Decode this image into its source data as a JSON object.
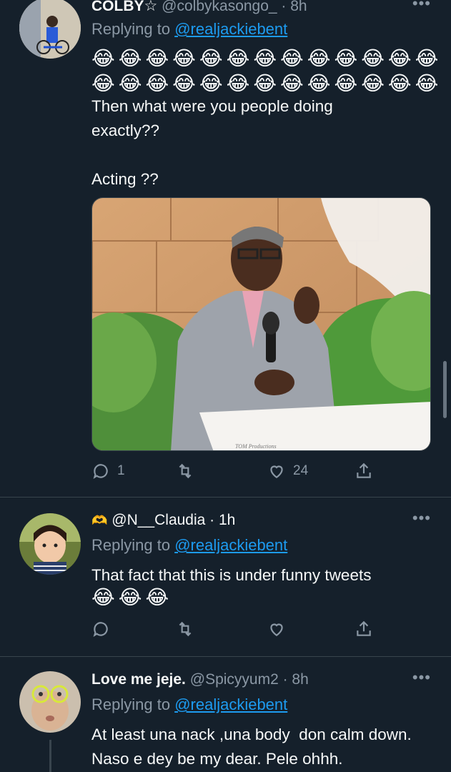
{
  "tweets": [
    {
      "name": "COLBY☆",
      "handle": "@colbykasongo_ · 8h",
      "replying_prefix": "Replying to ",
      "replying_handle": "@realjackiebent",
      "emoji": "😂",
      "emoji_rows": [
        13,
        13
      ],
      "text": "Then what were you people doing exactly??\n\nActing ??",
      "image_caption": "TOM Productions",
      "stats": {
        "replies": "1",
        "retweets": "",
        "likes": "24"
      }
    },
    {
      "name_icon": "🫶",
      "handle": "@N__Claudia · 1h",
      "replying_prefix": "Replying to ",
      "replying_handle": "@realjackiebent",
      "text": "That fact that this is under funny tweets",
      "emoji": "😂",
      "emoji_rows": [
        3
      ],
      "stats": {
        "replies": "",
        "retweets": "",
        "likes": ""
      }
    },
    {
      "name": "Love me jeje.",
      "handle": "@Spicyyum2 · 8h",
      "replying_prefix": "Replying to ",
      "replying_handle": "@realjackiebent",
      "text": "At least una nack ,una body  don calm down.  Naso e dey be my dear. Pele ohhh."
    }
  ],
  "icons": {
    "reply": "reply-icon",
    "retweet": "retweet-icon",
    "like": "heart-icon",
    "share": "share-icon",
    "more": "more-icon"
  },
  "colors": {
    "background": "#15202b",
    "link": "#1d9bf0",
    "muted": "#8b98a5",
    "text": "#f7f9f9"
  }
}
